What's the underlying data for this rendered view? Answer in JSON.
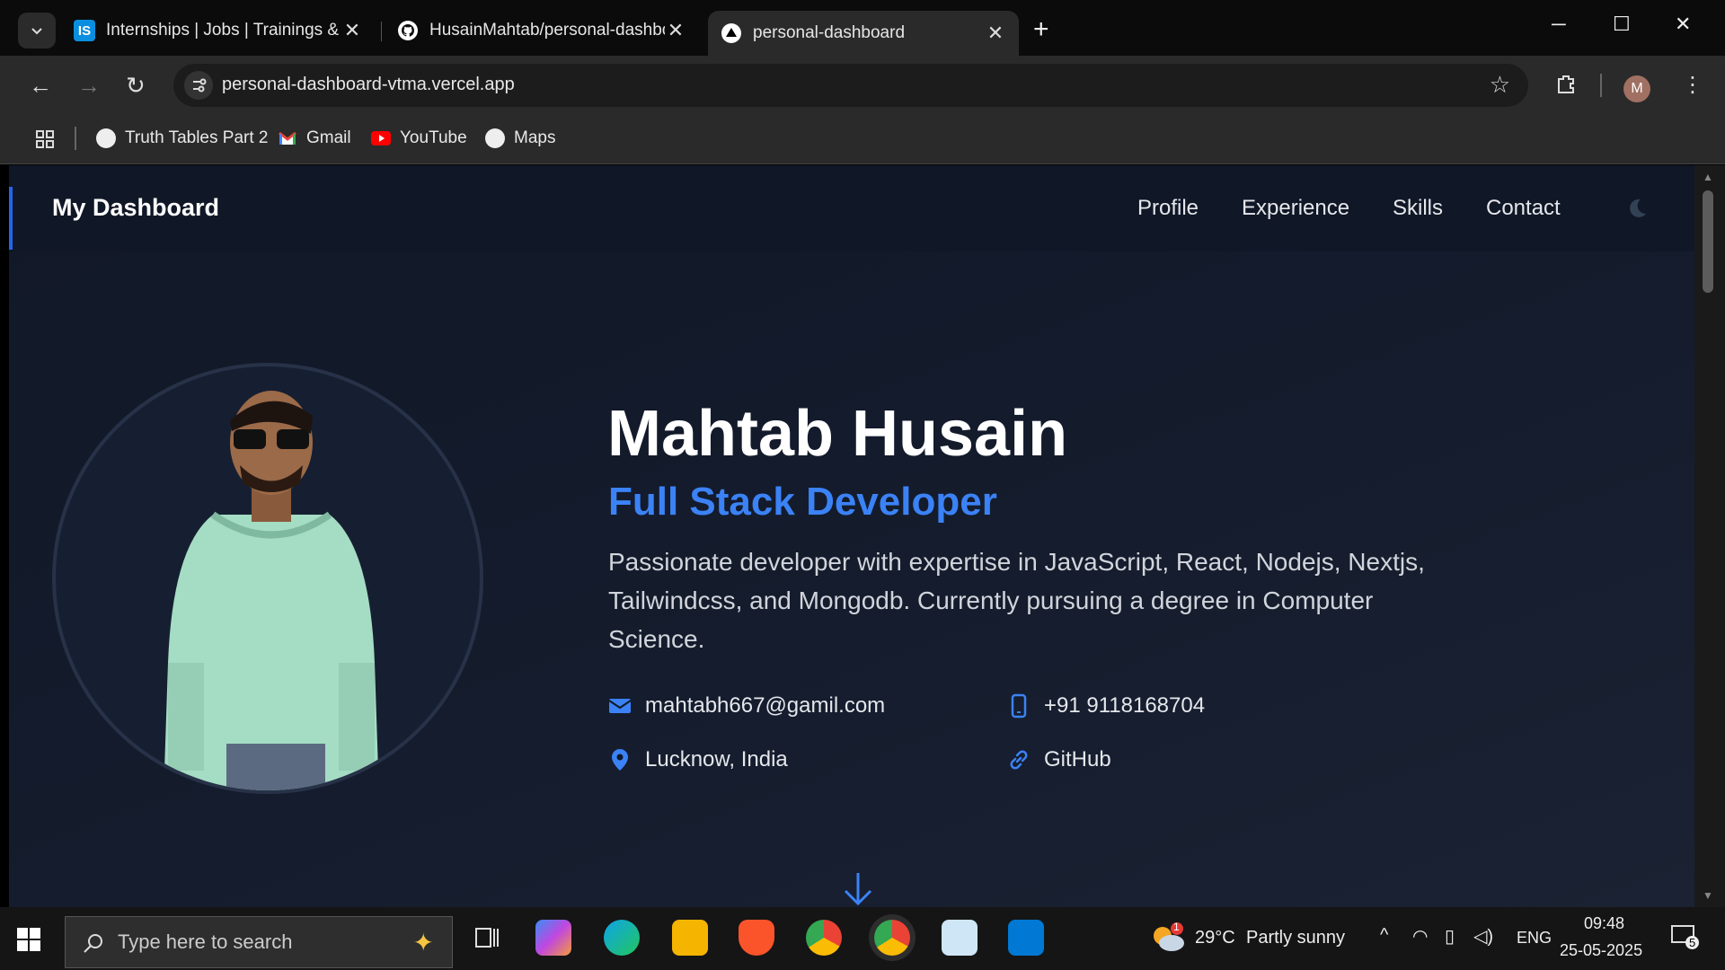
{
  "browser": {
    "tabs": [
      {
        "title": "Internships | Jobs | Trainings & I",
        "favicon": "internshala-icon"
      },
      {
        "title": "HusainMahtab/personal-dashbo",
        "favicon": "github-icon"
      },
      {
        "title": "personal-dashboard",
        "favicon": "vercel-icon"
      }
    ],
    "url": "personal-dashboard-vtma.vercel.app",
    "profile_initial": "M",
    "bookmarks": [
      "Truth Tables Part 2",
      "Gmail",
      "YouTube",
      "Maps"
    ]
  },
  "site": {
    "brand": "My Dashboard",
    "nav": [
      "Profile",
      "Experience",
      "Skills",
      "Contact"
    ],
    "name": "Mahtab Husain",
    "role": "Full Stack Developer",
    "bio": "Passionate developer with expertise in JavaScript, React, Nodejs, Nextjs, Tailwindcss, and Mongodb. Currently pursuing a degree in Computer Science.",
    "email": "mahtabh667@gamil.com",
    "phone": "+91 9118168704",
    "location": "Lucknow, India",
    "github": "GitHub",
    "accent_color": "#3b82f6"
  },
  "taskbar": {
    "search_placeholder": "Type here to search",
    "weather_temp": "29°C",
    "weather_text": "Partly sunny",
    "weather_badge": "1",
    "lang": "ENG",
    "time": "09:48",
    "date": "25-05-2025",
    "notifications": "5"
  }
}
